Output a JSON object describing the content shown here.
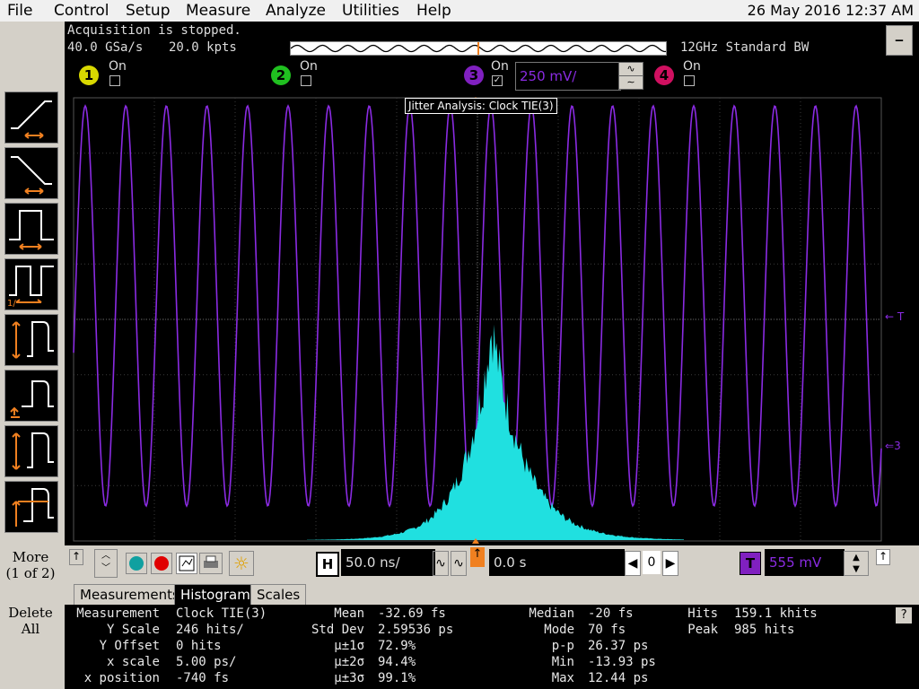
{
  "menu": [
    "File",
    "Control",
    "Setup",
    "Measure",
    "Analyze",
    "Utilities",
    "Help"
  ],
  "datetime": "26 May 2016 12:37 AM",
  "status": {
    "line1": "Acquisition is stopped.",
    "sample_rate": "40.0 GSa/s",
    "points": "20.0 kpts",
    "bandwidth": "12GHz Standard BW",
    "minimize": "—"
  },
  "channels": [
    {
      "num": "1",
      "label": "On",
      "checked": false,
      "color": "#d8d800"
    },
    {
      "num": "2",
      "label": "On",
      "checked": false,
      "color": "#20c020"
    },
    {
      "num": "3",
      "label": "On",
      "checked": true,
      "color": "#8020c0",
      "scale": "250 mV/"
    },
    {
      "num": "4",
      "label": "On",
      "checked": false,
      "color": "#d01060"
    }
  ],
  "scope": {
    "waveform_label": "Jitter Analysis: Clock TIE(3)",
    "trigger_marker": "T",
    "channel_marker": "3",
    "waveform_color": "#8a2be2",
    "histogram_color": "#20e0e0"
  },
  "side": {
    "more": "More",
    "more_page": "(1 of 2)",
    "delete": "Delete",
    "delete_all": "All"
  },
  "controls": {
    "horizontal_label": "H",
    "timebase": "50.0 ns/",
    "delay": "0.0 s",
    "position": "0",
    "trigger_label": "T",
    "trigger_level": "555 mV"
  },
  "tabs": [
    "Measurements",
    "Histogram",
    "Scales"
  ],
  "results": {
    "help": "?",
    "col1": [
      [
        "Measurement",
        "Clock TIE(3)"
      ],
      [
        "Y Scale",
        "246 hits/"
      ],
      [
        "Y Offset",
        "0 hits"
      ],
      [
        "x scale",
        "5.00 ps/"
      ],
      [
        "x position",
        "-740 fs"
      ]
    ],
    "col2": [
      [
        "Mean",
        "-32.69 fs"
      ],
      [
        "Std Dev",
        "2.59536 ps"
      ],
      [
        "μ±1σ",
        "72.9%"
      ],
      [
        "μ±2σ",
        "94.4%"
      ],
      [
        "μ±3σ",
        "99.1%"
      ]
    ],
    "col3": [
      [
        "Median",
        "-20 fs"
      ],
      [
        "Mode",
        "70 fs"
      ],
      [
        "p-p",
        "26.37 ps"
      ],
      [
        "Min",
        "-13.93 ps"
      ],
      [
        "Max",
        "12.44 ps"
      ]
    ],
    "col4": [
      [
        "Hits",
        "159.1 khits"
      ],
      [
        "Peak",
        "985 hits"
      ]
    ]
  }
}
